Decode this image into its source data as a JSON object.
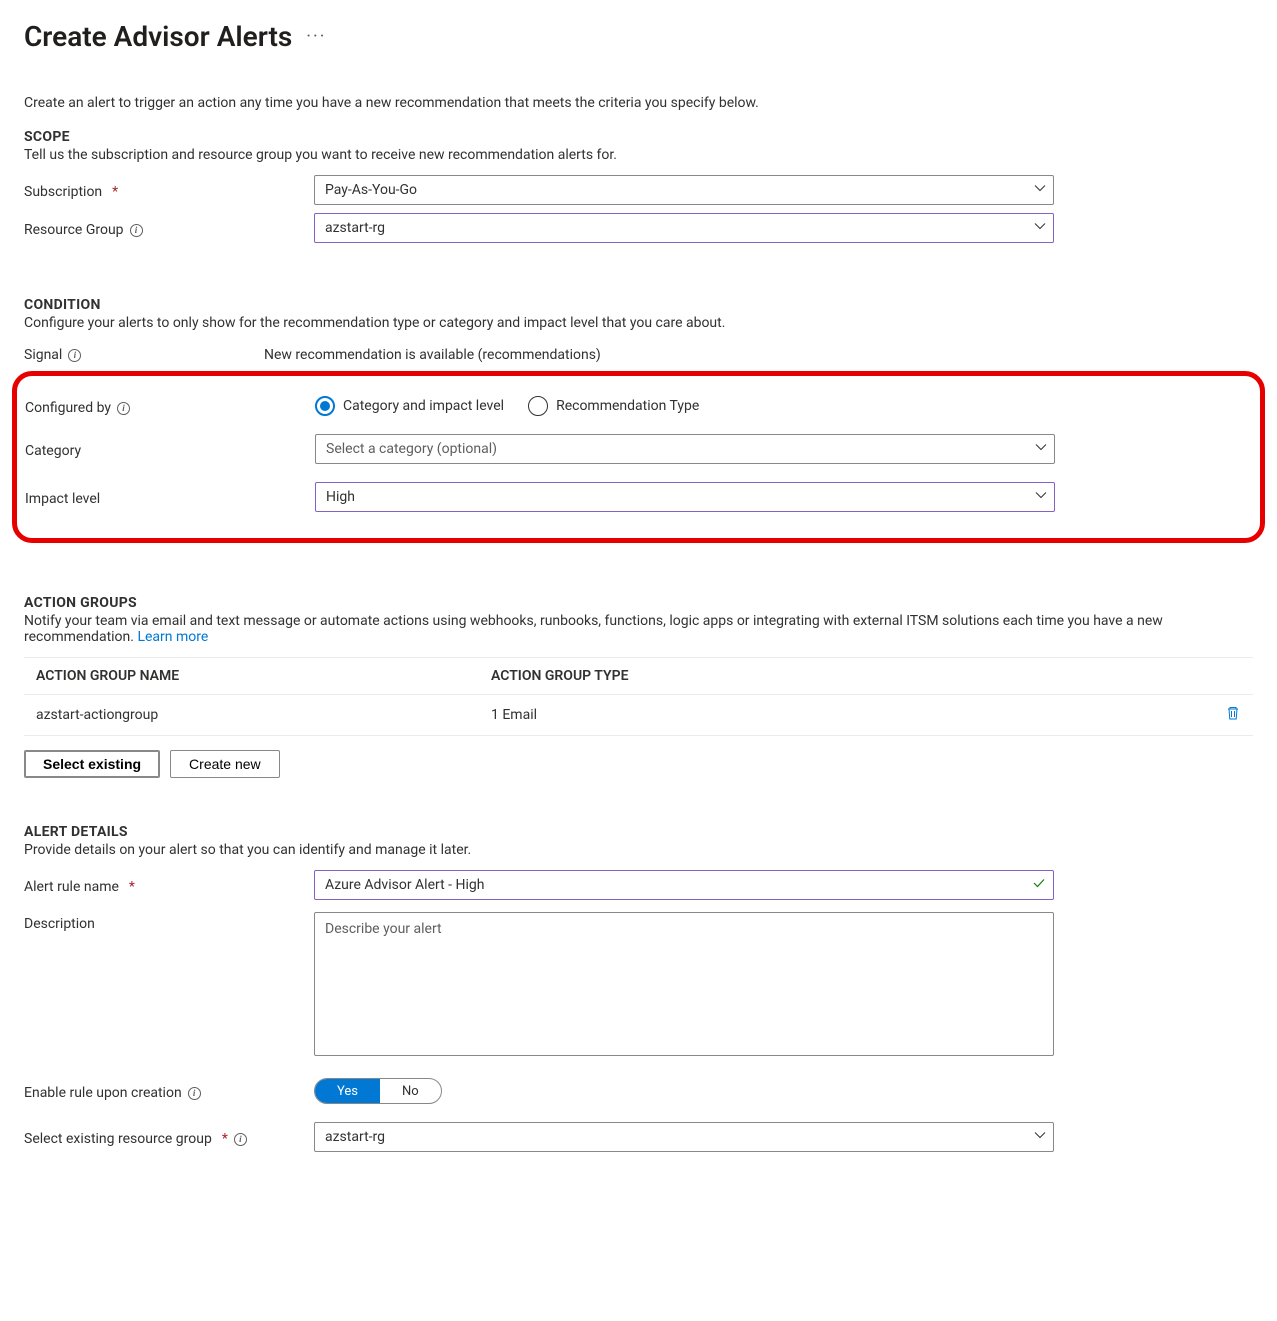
{
  "page": {
    "title": "Create Advisor Alerts",
    "intro": "Create an alert to trigger an action any time you have a new recommendation that meets the criteria you specify below."
  },
  "scope": {
    "heading": "SCOPE",
    "desc": "Tell us the subscription and resource group you want to receive new recommendation alerts for.",
    "subscription_label": "Subscription",
    "subscription_value": "Pay-As-You-Go",
    "resource_group_label": "Resource Group",
    "resource_group_value": "azstart-rg"
  },
  "condition": {
    "heading": "CONDITION",
    "desc": "Configure your alerts to only show for the recommendation type or category and impact level that you care about.",
    "signal_label": "Signal",
    "signal_value": "New recommendation is available (recommendations)",
    "configured_by_label": "Configured by",
    "radio_category": "Category and impact level",
    "radio_recommendation": "Recommendation Type",
    "configured_by_selected": "category",
    "category_label": "Category",
    "category_placeholder": "Select a category (optional)",
    "impact_label": "Impact level",
    "impact_value": "High"
  },
  "action_groups": {
    "heading": "ACTION GROUPS",
    "desc_pre": "Notify your team via email and text message or automate actions using webhooks, runbooks, functions, logic apps or integrating with external ITSM solutions each time you have a new recommendation. ",
    "learn_more": "Learn more",
    "col_name": "ACTION GROUP NAME",
    "col_type": "ACTION GROUP TYPE",
    "rows": [
      {
        "name": "azstart-actiongroup",
        "type": "1 Email"
      }
    ],
    "btn_select_existing": "Select existing",
    "btn_create_new": "Create new"
  },
  "alert_details": {
    "heading": "ALERT DETAILS",
    "desc": "Provide details on your alert so that you can identify and manage it later.",
    "name_label": "Alert rule name",
    "name_value": "Azure Advisor Alert - High",
    "description_label": "Description",
    "description_placeholder": "Describe your alert",
    "enable_label": "Enable rule upon creation",
    "toggle_yes": "Yes",
    "toggle_no": "No",
    "enable_value": "yes",
    "existing_rg_label": "Select existing resource group",
    "existing_rg_value": "azstart-rg"
  }
}
